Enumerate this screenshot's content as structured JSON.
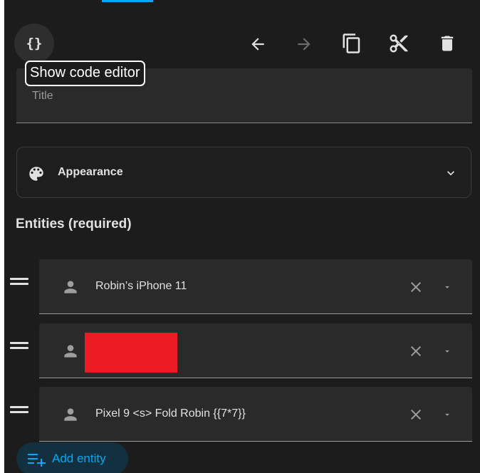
{
  "toolbar": {
    "code_label": "{}",
    "tooltip": "Show code editor",
    "icons": [
      "code-braces-icon",
      "undo-arrow-icon",
      "redo-arrow-icon",
      "copy-icon",
      "cut-icon",
      "delete-icon"
    ]
  },
  "title_field": {
    "label": "Title",
    "value": ""
  },
  "appearance": {
    "label": "Appearance",
    "icon": "palette-icon"
  },
  "entities": {
    "heading": "Entities (required)",
    "items": [
      {
        "label": "Robin’s iPhone 11",
        "redacted": false
      },
      {
        "label": "",
        "redacted": true
      },
      {
        "label": "Pixel 9 <s> Fold Robin {{7*7}}",
        "redacted": false
      }
    ],
    "add_label": "Add entity"
  },
  "colors": {
    "background": "#1c1c1c",
    "field": "#2a2a2a",
    "accent": "#03a9f4",
    "redaction": "#ed1c24"
  }
}
